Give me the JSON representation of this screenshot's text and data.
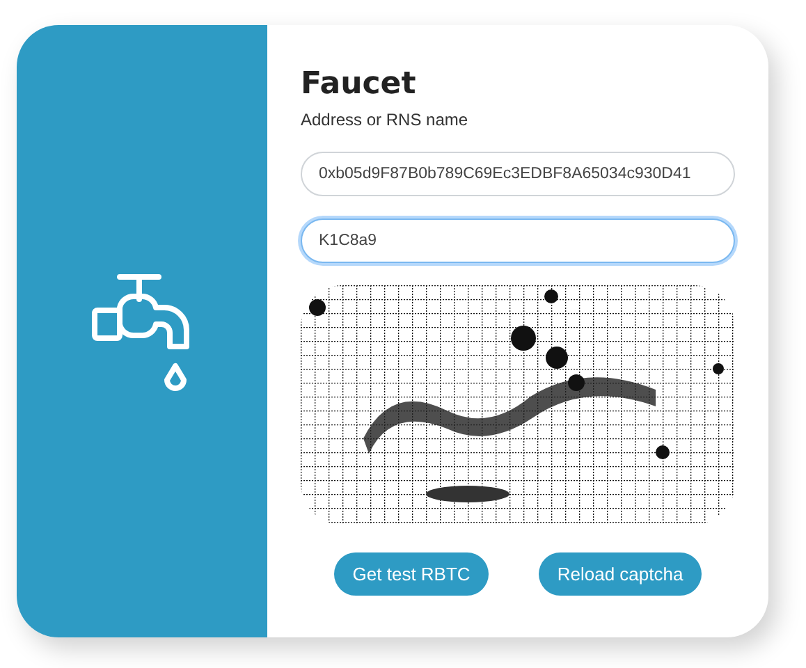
{
  "title": "Faucet",
  "address_label": "Address or RNS name",
  "fields": [
    {
      "value": "0xb05d9F87B0b789C69Ec3EDBF8A65034c930D41",
      "focused": false
    },
    {
      "value": "K1C8a9",
      "focused": true
    }
  ],
  "buttons": [
    "Get test RBTC",
    "Reload captcha"
  ]
}
